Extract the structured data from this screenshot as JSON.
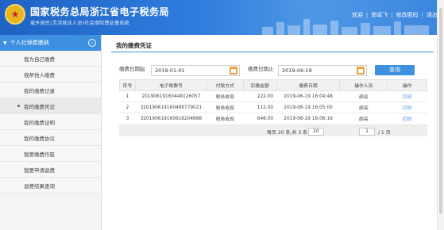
{
  "header": {
    "title": "国家税务总局浙江省电子税务局",
    "subtitle": "城乡居民(灵活就业人员)社会保险费征缴系统",
    "links": [
      "欢迎",
      "郑卓飞",
      "修改密码",
      "退出"
    ]
  },
  "sidebar": {
    "section_label": "个人社保费缴纳",
    "items": [
      {
        "label": "我为自己缴费"
      },
      {
        "label": "我帮他人缴费"
      },
      {
        "label": "我的缴费记录"
      },
      {
        "label": "我的缴费凭证"
      },
      {
        "label": "我的缴费证明"
      },
      {
        "label": "我的缴费协议"
      },
      {
        "label": "我要缴费作废"
      },
      {
        "label": "我要申请退费"
      },
      {
        "label": "退费结果查询"
      }
    ]
  },
  "main": {
    "title": "我的缴费凭证",
    "filters": {
      "start_label": "缴费日期起",
      "start_value": "2019-01-01",
      "end_label": "缴费日期止",
      "end_value": "2019-06-19",
      "query_label": "查询"
    },
    "table": {
      "headers": [
        "序号",
        "电子税票号",
        "付款方式",
        "实缴金额",
        "缴费日期",
        "操作人员",
        "操作"
      ],
      "rows": [
        {
          "no": "1",
          "ticket": "2019061916044812605​7",
          "pay": "税务收现",
          "amount": "222.00",
          "date": "2019-06-19 16:04:48",
          "operator": "颜亮",
          "op": "打印"
        },
        {
          "no": "2",
          "ticket": "320190619160499779021",
          "pay": "税务收现",
          "amount": "112.00",
          "date": "2019-06-19 16:05:00",
          "operator": "颜亮",
          "op": "打印"
        },
        {
          "no": "3",
          "ticket": "320190619160616204888",
          "pay": "税务收现",
          "amount": "648.00",
          "date": "2019-06-19 16:06:16",
          "operator": "颜亮",
          "op": "打印"
        }
      ]
    },
    "pager": {
      "summary": "每页 20 条,共 3 条",
      "page_size": "20",
      "current_page": "1",
      "total_pages": "/ 1 页"
    }
  },
  "colors": {
    "header_blue": "#2f7ddd",
    "accent_blue": "#3d8fe0",
    "calendar_orange": "#f2a13a"
  }
}
